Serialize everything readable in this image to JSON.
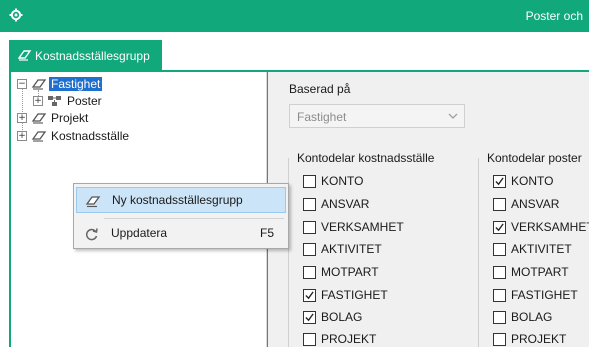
{
  "window": {
    "title": "Poster och",
    "app_icon": "gear-icon"
  },
  "tabs": [
    {
      "label": "Kostnadsställesgrupp",
      "icon": "eraser-icon",
      "active": true
    }
  ],
  "tree": {
    "nodes": [
      {
        "label": "Fastighet",
        "expander": "−",
        "icon": "eraser-icon",
        "selected": true
      },
      {
        "label": "Poster",
        "expander": "+",
        "icon": "nodes-icon",
        "selected": false
      },
      {
        "label": "Projekt",
        "expander": "+",
        "icon": "eraser-icon",
        "selected": false
      },
      {
        "label": "Kostnadsställe",
        "expander": "+",
        "icon": "eraser-icon",
        "selected": false
      }
    ]
  },
  "panel": {
    "based_on_label": "Baserad på",
    "based_on_value": "Fastighet",
    "groups": [
      {
        "title": "Kontodelar kostnadsställe",
        "items": [
          {
            "label": "KONTO",
            "checked": false
          },
          {
            "label": "ANSVAR",
            "checked": false
          },
          {
            "label": "VERKSAMHET",
            "checked": false
          },
          {
            "label": "AKTIVITET",
            "checked": false
          },
          {
            "label": "MOTPART",
            "checked": false
          },
          {
            "label": "FASTIGHET",
            "checked": true
          },
          {
            "label": "BOLAG",
            "checked": true
          },
          {
            "label": "PROJEKT",
            "checked": false
          }
        ]
      },
      {
        "title": "Kontodelar poster",
        "items": [
          {
            "label": "KONTO",
            "checked": true
          },
          {
            "label": "ANSVAR",
            "checked": false
          },
          {
            "label": "VERKSAMHET",
            "checked": true
          },
          {
            "label": "AKTIVITET",
            "checked": false
          },
          {
            "label": "MOTPART",
            "checked": false
          },
          {
            "label": "FASTIGHET",
            "checked": false
          },
          {
            "label": "BOLAG",
            "checked": false
          },
          {
            "label": "PROJEKT",
            "checked": false
          }
        ]
      }
    ]
  },
  "context_menu": {
    "items": [
      {
        "label": "Ny kostnadsställesgrupp",
        "icon": "eraser-icon",
        "shortcut": "",
        "highlighted": true
      },
      {
        "label": "Uppdatera",
        "icon": "refresh-icon",
        "shortcut": "F5",
        "highlighted": false
      }
    ]
  },
  "colors": {
    "accent": "#11a87c",
    "selection": "#1f6fce",
    "menu_highlight": "#cce4f7"
  }
}
